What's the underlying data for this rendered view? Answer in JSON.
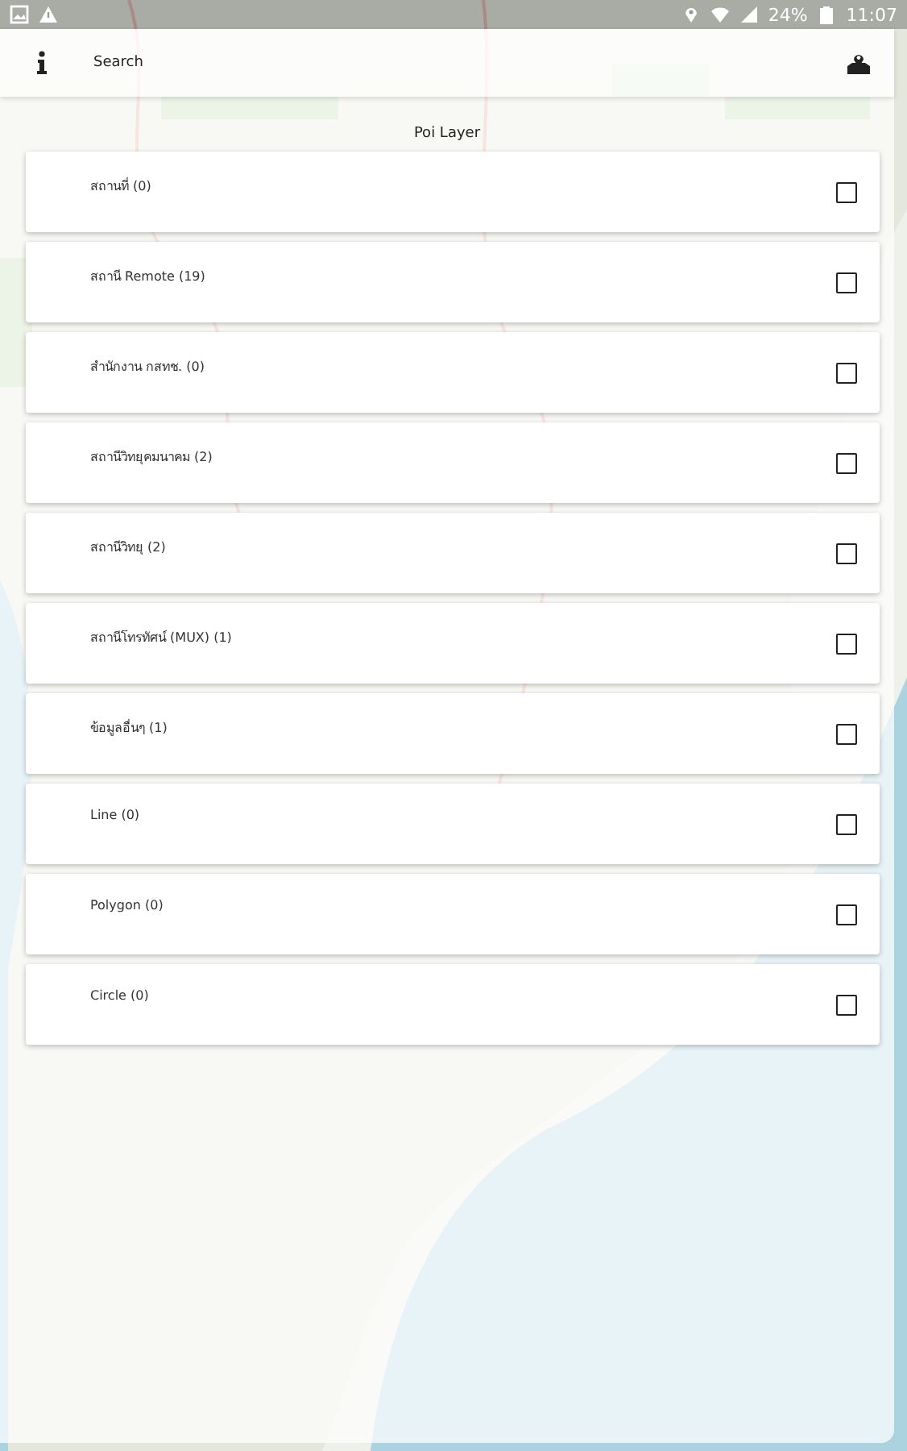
{
  "status_bar": {
    "battery_percent": "24%",
    "time": "11:07"
  },
  "toolbar": {
    "search": {
      "placeholder": "Search"
    }
  },
  "title": "Poi Layer",
  "layers": [
    {
      "label": "สถานที่ (0)",
      "checked": false
    },
    {
      "label": "สถานี Remote (19)",
      "checked": false
    },
    {
      "label": "สำนักงาน กสทช. (0)",
      "checked": false
    },
    {
      "label": "สถานีวิทยุคมนาคม (2)",
      "checked": false
    },
    {
      "label": "สถานีวิทยุ (2)",
      "checked": false
    },
    {
      "label": "สถานีโทรทัศน์ (MUX) (1)",
      "checked": false
    },
    {
      "label": "ข้อมูลอื่นๆ (1)",
      "checked": false
    },
    {
      "label": "Line (0)",
      "checked": false
    },
    {
      "label": "Polygon (0)",
      "checked": false
    },
    {
      "label": "Circle (0)",
      "checked": false
    }
  ]
}
